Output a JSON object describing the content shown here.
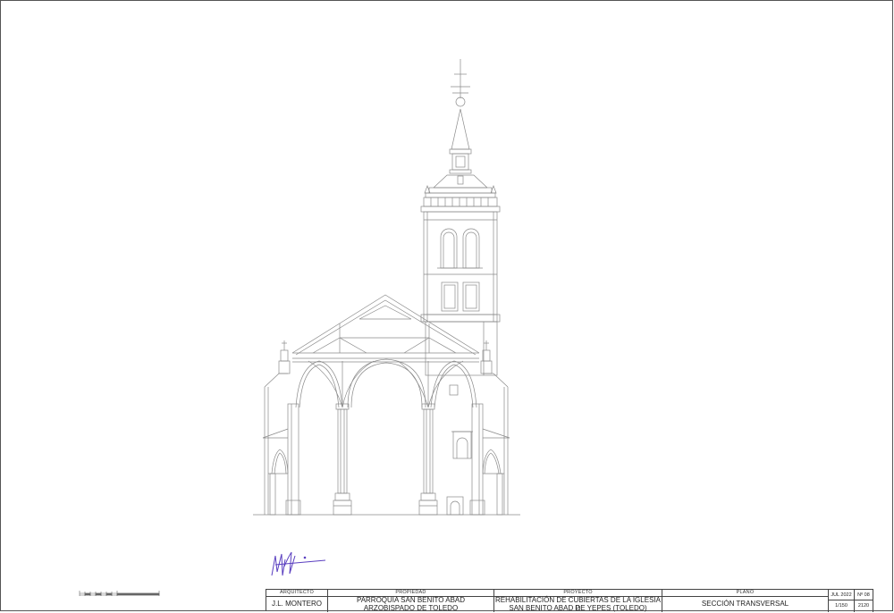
{
  "title_block": {
    "architect_label": "ARQUITECTO",
    "architect_name": "J.L. MONTERO",
    "owner_label": "PROPIEDAD",
    "owner_line1": "PARROQUIA SAN BENITO ABAD",
    "owner_line2": "ARZOBISPADO DE TOLEDO",
    "project_label": "PROYECTO",
    "project_line1": "REHABILITACIÓN DE CUBIERTAS DE LA IGLESIA P.",
    "project_line2": "SAN BENITO ABAD DE YEPES (TOLEDO)",
    "plan_label": "PLANO",
    "plan_name": "SECCIÓN TRANSVERSAL",
    "date": "JUL 2022",
    "sheet_number": "Nº 08",
    "scale": "1/150",
    "code": "2120"
  },
  "colors": {
    "line": "#8a8a8a",
    "frame": "#444444",
    "signature": "#5a3fc0"
  },
  "signature": "J.L. Montero (firma manuscrita)"
}
